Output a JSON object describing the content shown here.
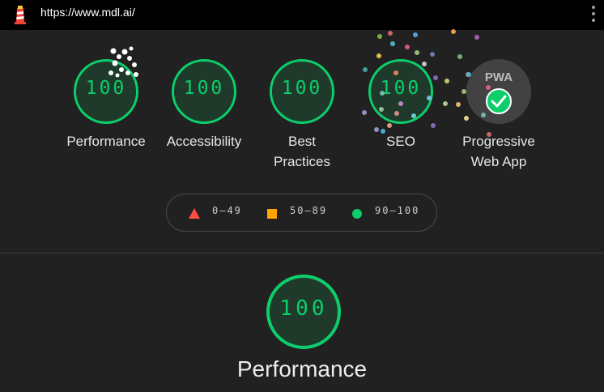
{
  "browser": {
    "url": "https://www.mdl.ai/"
  },
  "categories": [
    {
      "score": "100",
      "label_line1": "Performance",
      "label_line2": ""
    },
    {
      "score": "100",
      "label_line1": "Accessibility",
      "label_line2": ""
    },
    {
      "score": "100",
      "label_line1": "Best",
      "label_line2": "Practices"
    },
    {
      "score": "100",
      "label_line1": "SEO",
      "label_line2": ""
    }
  ],
  "pwa": {
    "badge_text": "PWA",
    "label_line1": "Progressive",
    "label_line2": "Web App"
  },
  "legend": [
    {
      "range": "0–49",
      "shape": "triangle",
      "color": "#ff4e42"
    },
    {
      "range": "50–89",
      "shape": "square",
      "color": "#ffa400"
    },
    {
      "range": "90–100",
      "shape": "circle",
      "color": "#0cce6b"
    }
  ],
  "main": {
    "score": "100",
    "title": "Performance"
  },
  "colors": {
    "pass": "#0cce6b",
    "background": "#212121",
    "topbar": "#000000"
  }
}
